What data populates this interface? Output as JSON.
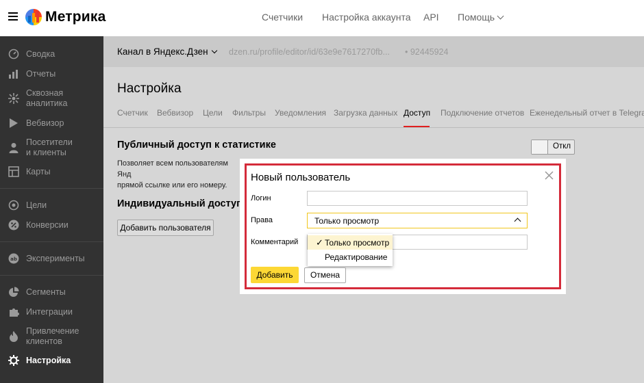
{
  "app": {
    "logo_text": "Метрика",
    "menu_icon": "hamburger-icon",
    "logo_icon": "metrika-logo-icon"
  },
  "topnav": {
    "items": [
      "Счетчики",
      "Настройка аккаунта",
      "API"
    ],
    "help_label": "Помощь"
  },
  "sidebar": {
    "items": [
      {
        "label": "Сводка",
        "icon": "dashboard-icon"
      },
      {
        "label": "Отчеты",
        "icon": "bar-chart-icon"
      },
      {
        "label": "Сквозная\nаналитика",
        "icon": "end-to-end-icon"
      },
      {
        "label": "Вебвизор",
        "icon": "play-icon"
      },
      {
        "label": "Посетители\nи клиенты",
        "icon": "person-icon"
      },
      {
        "label": "Карты",
        "icon": "map-icon"
      },
      {
        "label": "Цели",
        "icon": "target-icon"
      },
      {
        "label": "Конверсии",
        "icon": "percent-icon"
      },
      {
        "label": "Эксперименты",
        "icon": "ab-icon"
      },
      {
        "label": "Сегменты",
        "icon": "pie-icon"
      },
      {
        "label": "Интеграции",
        "icon": "puzzle-icon"
      },
      {
        "label": "Привлечение\nклиентов",
        "icon": "flame-icon"
      },
      {
        "label": "Настройка",
        "icon": "gear-icon"
      }
    ],
    "active_index": 12
  },
  "counter": {
    "name": "Канал в Яндекс.Дзен",
    "url": "dzen.ru/profile/editor/id/63e9e7617270fb...",
    "id": "• 92445924"
  },
  "page": {
    "title": "Настройка",
    "tabs": [
      "Счетчик",
      "Вебвизор",
      "Цели",
      "Фильтры",
      "Уведомления",
      "Загрузка данных",
      "Доступ",
      "Подключение отчетов",
      "Еженедельный отчет в Telegram"
    ],
    "active_tab": "Доступ"
  },
  "public_access": {
    "title": "Публичный доступ к статистике",
    "desc_line1": "Позволяет всем пользователям Янд",
    "desc_line2": "прямой ссылке или его номеру.",
    "toggle_label": "Откл"
  },
  "individual_access": {
    "title": "Индивидуальный доступ",
    "add_user_button": "Добавить пользователя"
  },
  "modal": {
    "title": "Новый пользователь",
    "login_label": "Логин",
    "login_value": "",
    "rights_label": "Права",
    "rights_value": "Только просмотр",
    "comment_label": "Комментарий",
    "comment_value": "",
    "options": [
      "Только просмотр",
      "Редактирование"
    ],
    "selected_option": "Только просмотр",
    "check_glyph": "✓",
    "add_button": "Добавить",
    "cancel_button": "Отмена"
  },
  "colors": {
    "sidebar_bg": "#323232",
    "main_overlay": "#d6d6d6",
    "accent_yellow": "#fdd835",
    "highlight_red": "#d42b3a",
    "active_tab_underline": "#e02020"
  }
}
